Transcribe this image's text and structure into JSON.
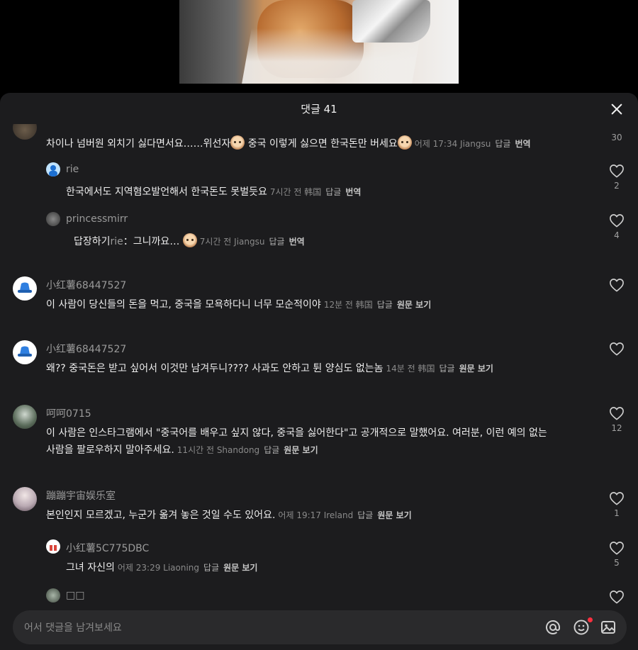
{
  "header": {
    "title": "댓글 41"
  },
  "comments": [
    {
      "text_before": "차이나 넘버원 외치기 싫다면서요……위선자",
      "text_mid": " 중국 이렇게 싫으면 한국돈만 버세요",
      "meta": "어제 17:34 Jiangsu",
      "reply": "답글",
      "translate": "번역",
      "likes": "30"
    },
    {
      "username": "rie",
      "text": "한국에서도 지역혐오발언해서 한국돈도 못벌듯요",
      "meta": "7시간 전 韩国",
      "reply": "답글",
      "translate": "번역",
      "likes": "2"
    },
    {
      "username": "princessmirr",
      "reply_prefix": "답장하기",
      "reply_to": "rie",
      "text": "：그니까요…",
      "meta": "7시간 전 Jiangsu",
      "reply": "답글",
      "translate": "번역",
      "likes": "4"
    },
    {
      "username": "小红薯68447527",
      "text": "이 사람이 당신들의 돈을 먹고, 중국을 모욕하다니 너무 모순적이야",
      "meta": "12분 전 韩国",
      "reply": "답글",
      "translate": "원문 보기"
    },
    {
      "username": "小红薯68447527",
      "text": "왜?? 중국돈은 받고 싶어서 이것만 남겨두니???? 사과도 안하고 튄 양심도 없는놈",
      "meta": "14분 전 韩国",
      "reply": "답글",
      "translate": "원문 보기"
    },
    {
      "username": "呵呵0715",
      "text_line1": "이 사람은 인스타그램에서 \"중국어를 배우고 싶지 않다, 중국을 싫어한다\"고 공개적으로 말했어요. 여러분, 이런 예의 없는",
      "text_line2": "사람을 팔로우하지 말아주세요.",
      "meta": "11시간 전 Shandong",
      "reply": "답글",
      "translate": "원문 보기",
      "likes": "12"
    },
    {
      "username": "蹦蹦宇宙娱乐室",
      "text": "본인인지 모르겠고, 누군가 옮겨 놓은 것일 수도 있어요.",
      "meta": "어제 19:17 Ireland",
      "reply": "답글",
      "translate": "원문 보기",
      "likes": "1"
    },
    {
      "username": "小红薯5C775DBC",
      "text": "그녀 자신의",
      "meta": "어제 23:29 Liaoning",
      "reply": "답글",
      "translate": "원문 보기",
      "likes": "5"
    },
    {
      "username": "□□"
    }
  ],
  "input": {
    "placeholder": "어서 댓글을 남겨보세요"
  },
  "icons": {
    "close": "close-icon",
    "like": "heart-outline-icon",
    "mention": "at-sign-icon",
    "emoji": "smiley-icon",
    "image": "image-icon"
  },
  "colors": {
    "sheet_bg": "#1c1c1e",
    "notify_dot": "#ff3040"
  }
}
